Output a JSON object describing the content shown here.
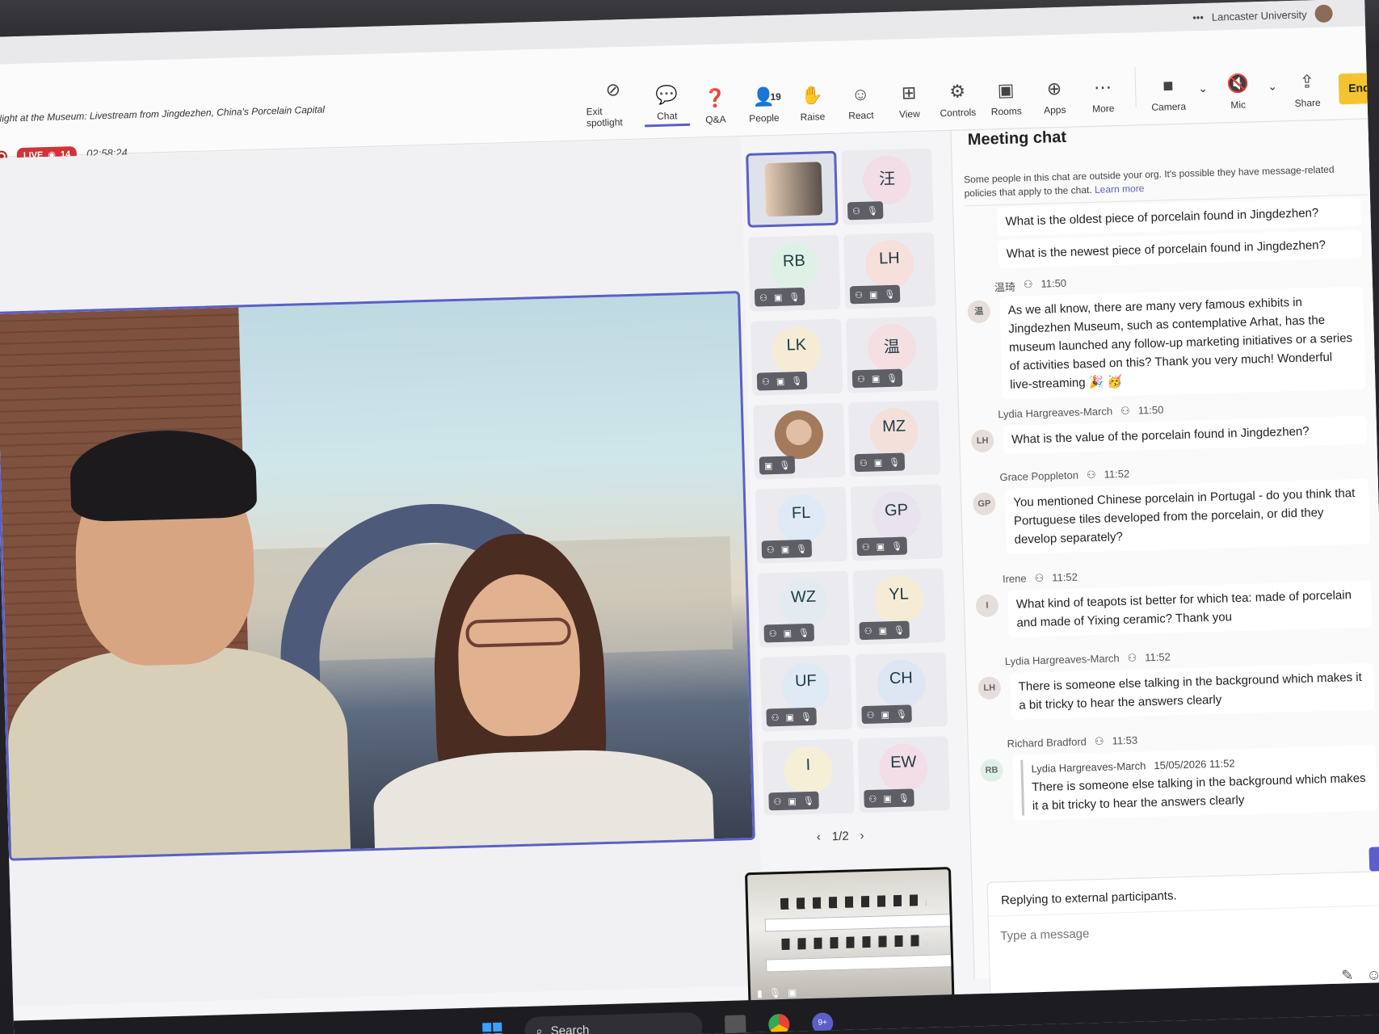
{
  "os": {
    "org_name": "Lancaster University"
  },
  "meeting": {
    "title": "Night at the Museum: Livestream from Jingdezhen, China's Porcelain Capital",
    "live_label": "LIVE",
    "viewer_count": "14",
    "elapsed": "02:58:24"
  },
  "toolbar": {
    "items": [
      {
        "label": "Exit spotlight",
        "icon": "exit-spotlight-icon"
      },
      {
        "label": "Chat",
        "icon": "chat-icon"
      },
      {
        "label": "Q&A",
        "icon": "qa-icon"
      },
      {
        "label": "People",
        "icon": "people-icon",
        "badge": "19"
      },
      {
        "label": "Raise",
        "icon": "raise-hand-icon"
      },
      {
        "label": "React",
        "icon": "react-icon"
      },
      {
        "label": "View",
        "icon": "view-icon"
      },
      {
        "label": "Controls",
        "icon": "controls-icon"
      },
      {
        "label": "Rooms",
        "icon": "rooms-icon"
      },
      {
        "label": "Apps",
        "icon": "apps-icon"
      },
      {
        "label": "More",
        "icon": "more-icon"
      }
    ],
    "camera_label": "Camera",
    "mic_label": "Mic",
    "share_label": "Share",
    "end_label": "End"
  },
  "participants": {
    "tiles": [
      {
        "initials": "",
        "kind": "video"
      },
      {
        "initials": "汪",
        "kind": "avatar",
        "color": "#f3dde6"
      },
      {
        "initials": "RB",
        "kind": "avatar",
        "color": "#dff1e6"
      },
      {
        "initials": "LH",
        "kind": "avatar",
        "color": "#f6e0dc"
      },
      {
        "initials": "LK",
        "kind": "avatar",
        "color": "#f6ecd6"
      },
      {
        "initials": "温",
        "kind": "avatar",
        "color": "#f5dfe3"
      },
      {
        "initials": "",
        "kind": "photo",
        "color": "#c9a98d"
      },
      {
        "initials": "MZ",
        "kind": "avatar",
        "color": "#f4e0db"
      },
      {
        "initials": "FL",
        "kind": "avatar",
        "color": "#dfeaf6"
      },
      {
        "initials": "GP",
        "kind": "avatar",
        "color": "#e9e2ef"
      },
      {
        "initials": "WZ",
        "kind": "avatar",
        "color": "#e3ebf0"
      },
      {
        "initials": "YL",
        "kind": "avatar",
        "color": "#f6ecd6"
      },
      {
        "initials": "UF",
        "kind": "avatar",
        "color": "#e0eaf5"
      },
      {
        "initials": "CH",
        "kind": "avatar",
        "color": "#dfe6f3"
      },
      {
        "initials": "I",
        "kind": "avatar",
        "color": "#f6efd8"
      },
      {
        "initials": "EW",
        "kind": "avatar",
        "color": "#f3dde6"
      }
    ],
    "page": "1/2"
  },
  "chat": {
    "title": "Meeting chat",
    "external_note": "Some people in this chat are outside your org. It's possible they have message-related policies that apply to the chat.",
    "learn_more": "Learn more",
    "messages": [
      {
        "author": "",
        "time": "",
        "initials": "",
        "text": "What is the oldest piece of porcelain found in Jingdezhen?"
      },
      {
        "author": "",
        "time": "",
        "initials": "",
        "text": "What is the newest piece of porcelain found in Jingdezhen?"
      },
      {
        "author": "温琦",
        "time": "11:50",
        "initials": "温",
        "text": "As we all know, there are many very famous exhibits in Jingdezhen Museum, such as contemplative Arhat, has the museum launched any follow-up marketing initiatives or a series of activities based on this? Thank you very much! Wonderful live-streaming 🎉 🥳"
      },
      {
        "author": "Lydia Hargreaves-March",
        "time": "11:50",
        "initials": "LH",
        "text": "What is the value of the porcelain found in Jingdezhen?"
      },
      {
        "author": "Grace Poppleton",
        "time": "11:52",
        "initials": "GP",
        "text": "You mentioned Chinese porcelain in Portugal - do you think that Portuguese tiles developed from the porcelain, or did they develop separately?"
      },
      {
        "author": "Irene",
        "time": "11:52",
        "initials": "I",
        "text": "What kind of teapots ist better for which tea: made of porcelain and made of Yixing ceramic? Thank you"
      },
      {
        "author": "Lydia Hargreaves-March",
        "time": "11:52",
        "initials": "LH",
        "text": "There is someone else talking in the background which makes it a bit tricky to hear the answers clearly"
      },
      {
        "author": "Richard Bradford",
        "time": "11:53",
        "initials": "RB",
        "text": ""
      }
    ],
    "quote": {
      "author": "Lydia Hargreaves-March",
      "datetime": "15/05/2026 11:52",
      "text": "There is someone else talking in the background which makes it a bit tricky to hear the answers clearly"
    },
    "reply_banner": "Replying to external participants.",
    "compose_placeholder": "Type a message"
  },
  "taskbar": {
    "search_label": "Search",
    "notification_badge": "9+"
  }
}
